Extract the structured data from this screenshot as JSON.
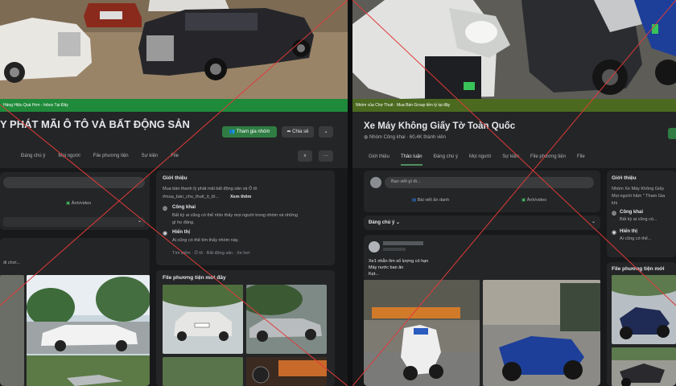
{
  "left": {
    "cover_bar_text": "Hàng Hiệu Quá Hơn - Inbox Tại Đây",
    "group_title": "Y PHÁT MÃI Ô TÔ VÀ BẤT ĐỘNG SẢN",
    "join_button": "Tham gia nhóm",
    "share_button": "Chia sẻ",
    "tabs": [
      "Đáng chú ý",
      "Mọi người",
      "File phương tiện",
      "Sự kiện",
      "File"
    ],
    "about_title": "Giới thiệu",
    "about_desc_1": "Mua bán thanh lý phát mãi bất động sản và Ô tô",
    "about_desc_2": "#mua_bán_cho_thuê_ô_tô...",
    "see_more": "Xem thêm",
    "public_label": "Công khai",
    "public_desc_1": "Bất kỳ ai cũng có thể nhìn thấy mọi người trong nhóm và những",
    "public_desc_2": "gì họ đăng.",
    "visible_label": "Hiển thị",
    "visible_desc": "Ai cũng có thể tìm thấy nhóm này.",
    "tags": "Tìm kiếm · Ô tô · Bất động sản · Xe hơi",
    "media_title": "File phương tiện mới đây",
    "photo_video": "Ảnh/video",
    "post_snippet": "đi chơi..."
  },
  "right": {
    "cover_bar_text": "Nhóm của Chợ Thuê · Mua Bán Group tiền tỷ tại đây",
    "group_title": "Xe Máy Không Giấy Tờ Toàn Quốc",
    "group_meta": "Nhóm Công khai · 60,4K thành viên",
    "tabs": [
      "Giới thiệu",
      "Thảo luận",
      "Đáng chú ý",
      "Mọi người",
      "Sự kiện",
      "File phương tiện",
      "File"
    ],
    "composer_placeholder": "Bạn viết gì đi...",
    "anonymous_post": "Bài viết ẩn danh",
    "photo_video": "Ảnh/video",
    "featured": "Đáng chú ý",
    "post_line_1": "Xe1 nhẫn tìm số lượng có hạn",
    "post_line_2": "Máy nước ban ăn",
    "post_line_3": "Kẹt...",
    "about_title": "Giới thiệu",
    "about_desc_1": "Nhóm Xe Máy Không Giấy",
    "about_desc_2": "Mọi người hãm \" Tham Gia",
    "about_desc_3": "khi",
    "public_label": "Công khai",
    "public_desc": "Bất kỳ ai cũng có...",
    "visible_label": "Hiển thị",
    "visible_desc": "Ai cũng có thể...",
    "media_title": "File phương tiện mới"
  }
}
